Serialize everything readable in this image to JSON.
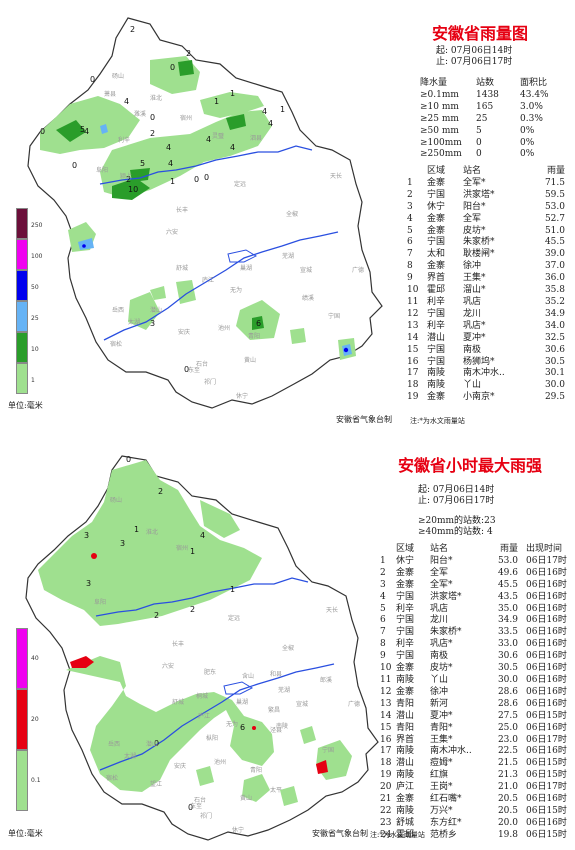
{
  "rain_map": {
    "title": "安徽省雨量图",
    "period_start": "起: 07月06日14时",
    "period_end": "止: 07月06日17时",
    "stats_headers": [
      "降水量",
      "站数",
      "面积比"
    ],
    "stats": [
      [
        "≥0.1mm",
        "1438",
        "43.4%"
      ],
      [
        "≥10 mm",
        "165",
        "3.0%"
      ],
      [
        "≥25 mm",
        "25",
        "0.3%"
      ],
      [
        "≥50 mm",
        "5",
        "0%"
      ],
      [
        "≥100mm",
        "0",
        "0%"
      ],
      [
        "≥250mm",
        "0",
        "0%"
      ]
    ],
    "table_headers": [
      "区域",
      "站名",
      "雨量"
    ],
    "stations": [
      [
        "1",
        "金寨",
        "全军*",
        "71.5"
      ],
      [
        "2",
        "宁国",
        "洪家塔*",
        "59.5"
      ],
      [
        "3",
        "休宁",
        "阳台*",
        "53.0"
      ],
      [
        "4",
        "金寨",
        "全军",
        "52.7"
      ],
      [
        "5",
        "金寨",
        "皮坊*",
        "51.0"
      ],
      [
        "6",
        "宁国",
        "朱家桥*",
        "45.5"
      ],
      [
        "7",
        "太和",
        "耿楼闸*",
        "39.0"
      ],
      [
        "8",
        "金寨",
        "徐冲",
        "37.0"
      ],
      [
        "9",
        "界首",
        "王集*",
        "36.0"
      ],
      [
        "10",
        "霍邱",
        "溜山*",
        "35.8"
      ],
      [
        "11",
        "利辛",
        "巩店",
        "35.2"
      ],
      [
        "12",
        "宁国",
        "龙川",
        "34.9"
      ],
      [
        "13",
        "利辛",
        "巩店*",
        "34.0"
      ],
      [
        "14",
        "潜山",
        "夏冲*",
        "32.5"
      ],
      [
        "15",
        "宁国",
        "南极",
        "30.6"
      ],
      [
        "16",
        "宁国",
        "杨狮坞*",
        "30.5"
      ],
      [
        "17",
        "南陵",
        "南木冲水..",
        "30.1"
      ],
      [
        "18",
        "南陵",
        "丫山",
        "30.0"
      ],
      [
        "19",
        "金寨",
        "小南京*",
        "29.5"
      ]
    ],
    "legend_values": [
      "250",
      "100",
      "50",
      "25",
      "10",
      "1"
    ],
    "legend_colors": [
      "#6b0f3a",
      "#f000f0",
      "#0000ee",
      "#66b3f5",
      "#2a9d2a",
      "#9fe08f"
    ],
    "unit": "单位:毫米",
    "footer": "安徽省气象台制",
    "note": "注:*为水文雨量站",
    "map_numbers": [
      "2",
      "0",
      "2",
      "1",
      "0",
      "4",
      "4",
      "1",
      "4",
      "5",
      "0",
      "4",
      "1",
      "0",
      "2",
      "4",
      "4",
      "4",
      "5",
      "0",
      "4",
      "2",
      "10",
      "1",
      "0",
      "3",
      "6",
      "0",
      "0"
    ],
    "map_places": [
      "砀山",
      "萧县",
      "宿州",
      "淮北",
      "濉溪",
      "灵璧",
      "泗县",
      "阜阳",
      "利辛",
      "颍上",
      "天长",
      "定远",
      "长丰",
      "全椒",
      "六安",
      "舒城",
      "巢湖",
      "庐江",
      "无为",
      "岳西",
      "潜山",
      "太湖",
      "宿松",
      "安庆",
      "池州",
      "青阳",
      "芜湖",
      "宣城",
      "广德",
      "宁国",
      "绩溪",
      "黄山",
      "休宁",
      "祁门",
      "东至",
      "石台"
    ]
  },
  "hourly_map": {
    "title": "安徽省小时最大雨强",
    "period_start": "起: 07月06日14时",
    "period_end": "止: 07月06日17时",
    "count_20": "≥20mm的站数:23",
    "count_40": "≥40mm的站数: 4",
    "table_headers": [
      "区域",
      "站名",
      "雨量",
      "出现时间"
    ],
    "stations": [
      [
        "1",
        "休宁",
        "阳台*",
        "53.0",
        "06日17时"
      ],
      [
        "2",
        "金寨",
        "全军",
        "49.6",
        "06日16时"
      ],
      [
        "3",
        "金寨",
        "全军*",
        "45.5",
        "06日16时"
      ],
      [
        "4",
        "宁国",
        "洪家塔*",
        "43.5",
        "06日16时"
      ],
      [
        "5",
        "利辛",
        "巩店",
        "35.0",
        "06日16时"
      ],
      [
        "6",
        "宁国",
        "龙川",
        "34.9",
        "06日16时"
      ],
      [
        "7",
        "宁国",
        "朱家桥*",
        "33.5",
        "06日16时"
      ],
      [
        "8",
        "利辛",
        "巩店*",
        "33.0",
        "06日16时"
      ],
      [
        "9",
        "宁国",
        "南极",
        "30.6",
        "06日16时"
      ],
      [
        "10",
        "金寨",
        "皮坊*",
        "30.5",
        "06日16时"
      ],
      [
        "11",
        "南陵",
        "丫山",
        "30.0",
        "06日16时"
      ],
      [
        "12",
        "金寨",
        "徐冲",
        "28.6",
        "06日16时"
      ],
      [
        "13",
        "青阳",
        "新河",
        "28.6",
        "06日16时"
      ],
      [
        "14",
        "潜山",
        "夏冲*",
        "27.5",
        "06日15时"
      ],
      [
        "15",
        "青阳",
        "青阳*",
        "25.0",
        "06日16时"
      ],
      [
        "16",
        "界首",
        "王集*",
        "23.0",
        "06日17时"
      ],
      [
        "17",
        "南陵",
        "南木冲水..",
        "22.5",
        "06日16时"
      ],
      [
        "18",
        "潜山",
        "痘姆*",
        "21.5",
        "06日15时"
      ],
      [
        "19",
        "南陵",
        "红旗",
        "21.3",
        "06日15时"
      ],
      [
        "20",
        "庐江",
        "王岗*",
        "21.0",
        "06日17时"
      ],
      [
        "21",
        "金寨",
        "红石嘴*",
        "20.5",
        "06日16时"
      ],
      [
        "22",
        "南陵",
        "万兴*",
        "20.5",
        "06日15时"
      ],
      [
        "23",
        "舒城",
        "东方红*",
        "20.0",
        "06日16时"
      ],
      [
        "24",
        "霍邱",
        "范桥乡",
        "19.8",
        "06日15时"
      ]
    ],
    "legend_values": [
      "40",
      "20",
      "0.1"
    ],
    "legend_colors": [
      "#f000f0",
      "#e60012",
      "#9fe08f"
    ],
    "unit": "单位:毫米",
    "footer": "安徽省气象台制",
    "note": "注:*为水文雨量站",
    "map_numbers": [
      "0",
      "2",
      "3",
      "1",
      "3",
      "1",
      "4",
      "3",
      "1",
      "2",
      "2",
      "0",
      "6",
      "0"
    ],
    "map_places": [
      "砀山",
      "宿州",
      "淮北",
      "阜阳",
      "天长",
      "定远",
      "全椒",
      "长丰",
      "六安",
      "舒城",
      "巢湖",
      "肥东",
      "庐江",
      "无为",
      "含山",
      "和县",
      "岳西",
      "潜山",
      "太湖",
      "宿松",
      "桐城",
      "枞阳",
      "安庆",
      "池州",
      "青阳",
      "芜湖",
      "南陵",
      "宣城",
      "郎溪",
      "广德",
      "宁国",
      "泾县",
      "太平",
      "黄山",
      "休宁",
      "祁门",
      "东至",
      "石台",
      "望江",
      "繁昌"
    ]
  }
}
